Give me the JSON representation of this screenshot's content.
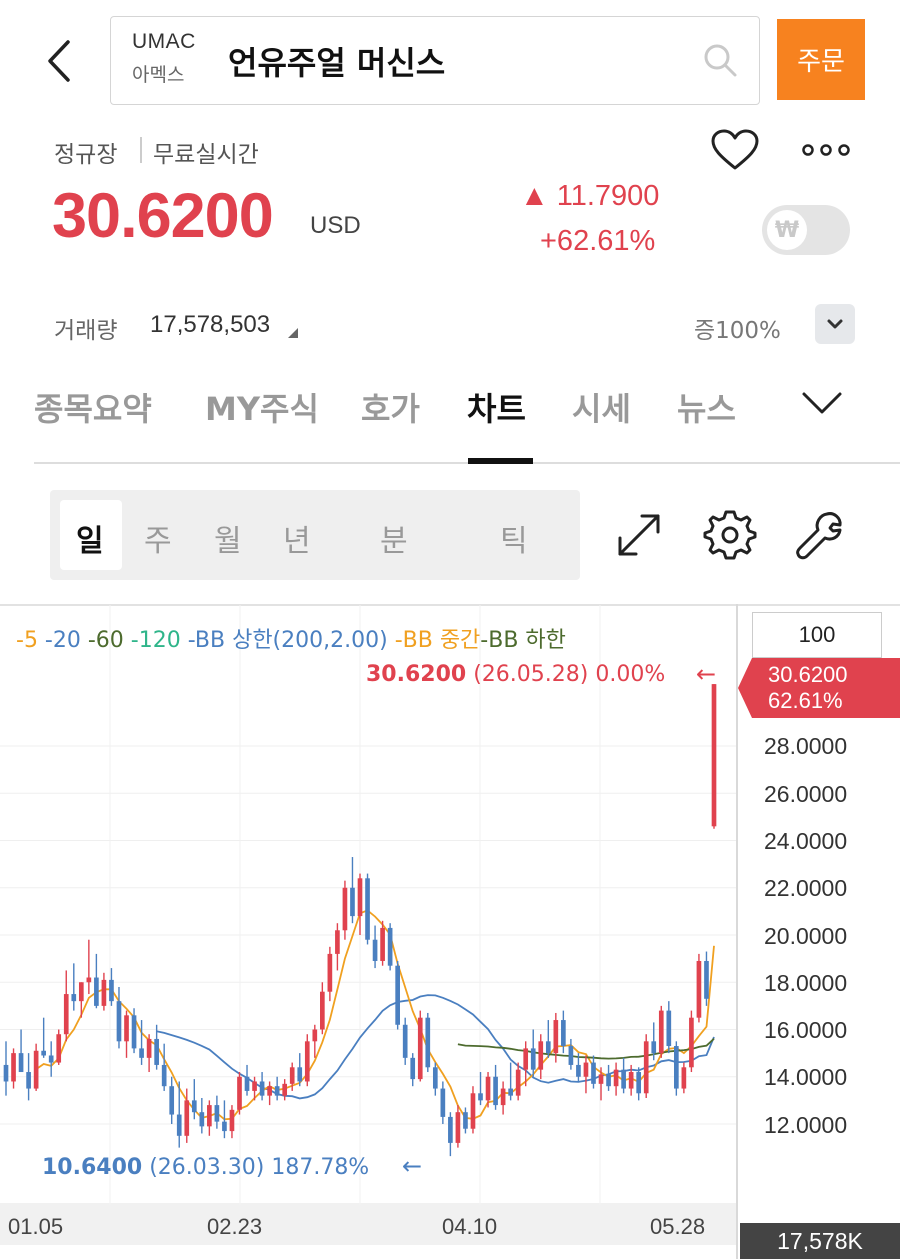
{
  "header": {
    "ticker": "UMAC",
    "ticker_korean": "아멕스",
    "stock_name": "언유주얼 머신스",
    "order_label": "주문"
  },
  "market": {
    "session": "정규장",
    "realtime": "무료실시간"
  },
  "quote": {
    "price": "30.6200",
    "currency": "USD",
    "change": "▲ 11.7900",
    "change_pct": "+62.61%",
    "toggle_symbol": "₩"
  },
  "volume": {
    "label": "거래량",
    "value": "17,578,503",
    "margin": "증100%"
  },
  "tabs": [
    {
      "label": "종목요약"
    },
    {
      "label": "MY주식"
    },
    {
      "label": "호가"
    },
    {
      "label": "차트"
    },
    {
      "label": "시세"
    },
    {
      "label": "뉴스"
    }
  ],
  "periods": [
    "일",
    "주",
    "월",
    "년",
    "분",
    "틱"
  ],
  "icons": {
    "expand": "expand-icon",
    "settings": "gear-icon",
    "tools": "wrench-icon"
  },
  "colors": {
    "up": "#e0424e",
    "down": "#4a7fc0",
    "accent": "#f7821f",
    "ma5": "#f0a020",
    "ma20": "#4a7fc0",
    "ma60": "#4d6b2e",
    "ma120": "#2fb58a",
    "bb_upper": "#4a7fc0",
    "bb_mid": "#f0a020",
    "bb_lower": "#4d6b2e"
  },
  "chart_data": {
    "type": "candlestick",
    "legend": [
      {
        "label": "-5",
        "color": "#f0a020"
      },
      {
        "label": " -20",
        "color": "#4a7fc0"
      },
      {
        "label": " -60",
        "color": "#4d6b2e"
      },
      {
        "label": " -120",
        "color": "#2fb58a"
      },
      {
        "label": " -BB 상한(200,2.00)",
        "color": "#4a7fc0"
      },
      {
        "label": " -BB 중간",
        "color": "#f0a020"
      },
      {
        "label": "-BB 하한",
        "color": "#4d6b2e"
      }
    ],
    "zoom": "100",
    "high_price": "30.6200",
    "high_info": "(26.05.28) 0.00%",
    "high_arrow": "←",
    "low_price": "10.6400",
    "low_info": "(26.03.30) 187.78%",
    "low_arrow": "←",
    "current_tag_price": "30.6200",
    "current_tag_pct": "62.61%",
    "y_ticks": [
      "28.0000",
      "26.0000",
      "24.0000",
      "22.0000",
      "20.0000",
      "18.0000",
      "16.0000",
      "14.0000",
      "12.0000"
    ],
    "x_ticks": [
      "01.05",
      "02.23",
      "04.10",
      "05.28"
    ],
    "volume_badge": "17,578K",
    "ylim": [
      10,
      30.62
    ],
    "candles": [
      [
        14.5,
        15.5,
        13.2,
        13.8
      ],
      [
        13.8,
        15.2,
        13.5,
        15.0
      ],
      [
        15.0,
        16.0,
        14.5,
        14.2
      ],
      [
        14.2,
        15.0,
        13.0,
        13.5
      ],
      [
        13.5,
        15.4,
        13.4,
        15.1
      ],
      [
        15.1,
        16.5,
        14.8,
        14.9
      ],
      [
        14.9,
        15.5,
        14.0,
        14.6
      ],
      [
        14.6,
        16.0,
        14.5,
        15.8
      ],
      [
        15.8,
        18.5,
        15.5,
        17.5
      ],
      [
        17.5,
        18.8,
        16.8,
        17.2
      ],
      [
        17.2,
        18.0,
        16.5,
        18.0
      ],
      [
        18.0,
        19.8,
        17.5,
        18.2
      ],
      [
        18.2,
        19.2,
        16.9,
        17.0
      ],
      [
        17.0,
        18.4,
        16.8,
        18.1
      ],
      [
        18.1,
        18.6,
        17.0,
        17.2
      ],
      [
        17.2,
        17.8,
        15.2,
        15.5
      ],
      [
        15.5,
        16.8,
        14.8,
        16.6
      ],
      [
        16.6,
        16.9,
        15.0,
        15.2
      ],
      [
        15.2,
        16.4,
        14.5,
        14.8
      ],
      [
        14.8,
        15.8,
        14.2,
        15.6
      ],
      [
        15.6,
        16.2,
        14.3,
        14.5
      ],
      [
        14.5,
        15.4,
        13.4,
        13.6
      ],
      [
        13.6,
        14.0,
        12.0,
        12.4
      ],
      [
        12.4,
        13.8,
        11.0,
        11.5
      ],
      [
        11.5,
        13.5,
        11.2,
        13.0
      ],
      [
        13.0,
        13.9,
        12.2,
        12.5
      ],
      [
        12.5,
        13.1,
        11.6,
        11.9
      ],
      [
        11.9,
        13.0,
        11.5,
        12.8
      ],
      [
        12.8,
        13.2,
        11.8,
        12.1
      ],
      [
        12.1,
        13.0,
        11.4,
        11.7
      ],
      [
        11.7,
        12.8,
        11.4,
        12.6
      ],
      [
        12.6,
        14.2,
        12.4,
        14.0
      ],
      [
        14.0,
        14.5,
        13.2,
        13.4
      ],
      [
        13.4,
        14.0,
        13.0,
        13.8
      ],
      [
        13.8,
        14.2,
        13.0,
        13.2
      ],
      [
        13.2,
        13.8,
        12.8,
        13.6
      ],
      [
        13.6,
        14.0,
        13.0,
        13.2
      ],
      [
        13.2,
        13.9,
        13.0,
        13.7
      ],
      [
        13.7,
        14.6,
        13.4,
        14.4
      ],
      [
        14.4,
        15.0,
        13.6,
        13.8
      ],
      [
        13.8,
        15.8,
        13.6,
        15.5
      ],
      [
        15.5,
        16.2,
        14.8,
        16.0
      ],
      [
        16.0,
        18.0,
        15.8,
        17.6
      ],
      [
        17.6,
        19.5,
        17.2,
        19.2
      ],
      [
        19.2,
        20.5,
        18.5,
        20.2
      ],
      [
        20.2,
        22.3,
        19.8,
        22.0
      ],
      [
        22.0,
        23.3,
        20.5,
        20.8
      ],
      [
        20.8,
        22.6,
        20.0,
        22.4
      ],
      [
        22.4,
        22.6,
        19.6,
        19.8
      ],
      [
        19.8,
        20.4,
        18.6,
        18.9
      ],
      [
        18.9,
        20.6,
        18.7,
        20.3
      ],
      [
        20.3,
        20.5,
        18.5,
        18.7
      ],
      [
        18.7,
        18.9,
        16.0,
        16.2
      ],
      [
        16.2,
        16.5,
        14.5,
        14.8
      ],
      [
        14.8,
        15.0,
        13.6,
        13.9
      ],
      [
        13.9,
        16.8,
        13.8,
        16.5
      ],
      [
        16.5,
        16.7,
        14.2,
        14.4
      ],
      [
        14.4,
        14.6,
        13.2,
        13.5
      ],
      [
        13.5,
        13.8,
        12.0,
        12.3
      ],
      [
        12.3,
        12.5,
        10.64,
        11.2
      ],
      [
        11.2,
        12.8,
        11.0,
        12.5
      ],
      [
        12.5,
        12.7,
        11.6,
        11.8
      ],
      [
        11.8,
        13.6,
        11.6,
        13.3
      ],
      [
        13.3,
        14.2,
        12.8,
        13.0
      ],
      [
        13.0,
        14.2,
        12.7,
        14.0
      ],
      [
        14.0,
        14.5,
        12.6,
        12.8
      ],
      [
        12.8,
        13.8,
        12.4,
        13.5
      ],
      [
        13.5,
        14.6,
        13.0,
        13.2
      ],
      [
        13.2,
        14.6,
        13.0,
        14.3
      ],
      [
        14.3,
        15.5,
        13.6,
        15.2
      ],
      [
        15.2,
        16.0,
        14.0,
        14.3
      ],
      [
        14.3,
        15.8,
        13.9,
        15.5
      ],
      [
        15.5,
        16.4,
        14.8,
        15.0
      ],
      [
        15.0,
        16.7,
        14.6,
        16.4
      ],
      [
        16.4,
        16.8,
        15.0,
        15.3
      ],
      [
        15.3,
        15.6,
        14.3,
        14.5
      ],
      [
        14.5,
        15.0,
        13.8,
        14.0
      ],
      [
        14.0,
        14.9,
        13.3,
        14.6
      ],
      [
        14.6,
        14.9,
        13.5,
        13.7
      ],
      [
        13.7,
        14.4,
        13.0,
        14.1
      ],
      [
        14.1,
        14.5,
        13.4,
        13.6
      ],
      [
        13.6,
        14.6,
        13.2,
        14.3
      ],
      [
        14.3,
        14.8,
        13.3,
        13.5
      ],
      [
        13.5,
        14.5,
        13.2,
        14.2
      ],
      [
        14.2,
        14.4,
        13.0,
        13.3
      ],
      [
        13.3,
        15.8,
        13.1,
        15.5
      ],
      [
        15.5,
        16.3,
        14.7,
        15.0
      ],
      [
        15.0,
        17.0,
        14.8,
        16.8
      ],
      [
        16.8,
        17.2,
        15.0,
        15.3
      ],
      [
        15.3,
        15.5,
        13.2,
        13.5
      ],
      [
        13.5,
        14.6,
        13.3,
        14.4
      ],
      [
        14.4,
        16.8,
        14.2,
        16.5
      ],
      [
        16.5,
        19.2,
        16.3,
        18.9
      ],
      [
        18.9,
        19.3,
        17.0,
        17.3
      ],
      [
        24.6,
        30.62,
        24.5,
        30.62
      ]
    ]
  }
}
